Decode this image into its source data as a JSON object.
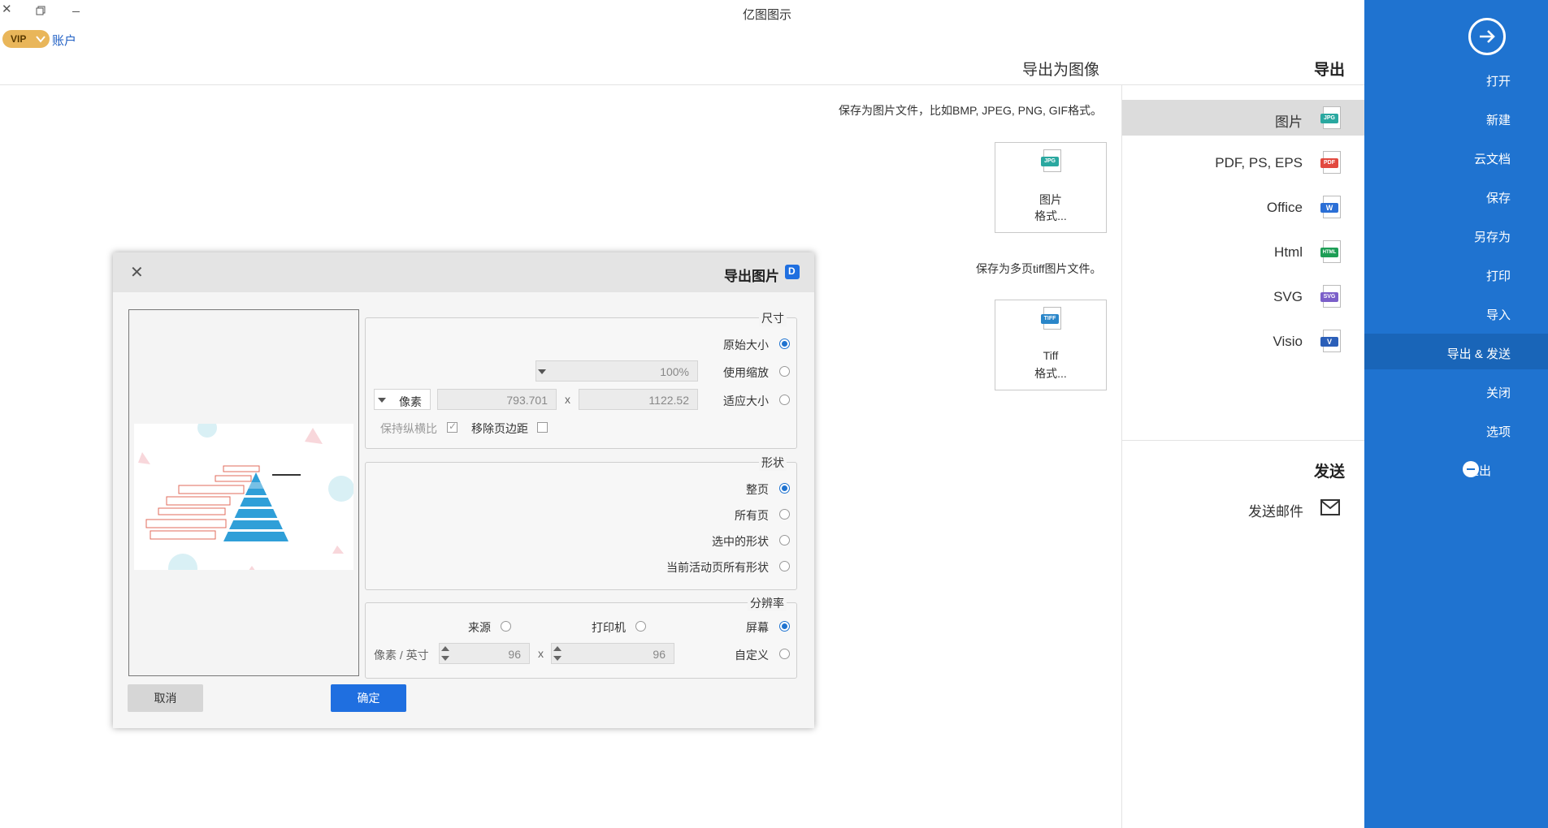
{
  "app": {
    "title": "亿图图示",
    "vip_label": "VIP",
    "user_label": "账户"
  },
  "sidebar": {
    "items": [
      {
        "label": "打开"
      },
      {
        "label": "新建"
      },
      {
        "label": "云文档"
      },
      {
        "label": "保存"
      },
      {
        "label": "另存为"
      },
      {
        "label": "打印"
      },
      {
        "label": "导入"
      },
      {
        "label": "导出 & 发送"
      },
      {
        "label": "关闭"
      },
      {
        "label": "选项"
      },
      {
        "label": "退出"
      }
    ],
    "active": "导出 & 发送"
  },
  "export_panel": {
    "heading": "导出",
    "formats": [
      {
        "label": "图片",
        "tag": "JPG",
        "color": "#2aa8a0"
      },
      {
        "label": "PDF, PS, EPS",
        "tag": "PDF",
        "color": "#e2493f"
      },
      {
        "label": "Office",
        "tag": "W",
        "color": "#2b6fd6"
      },
      {
        "label": "Html",
        "tag": "HTML",
        "color": "#1e9e56"
      },
      {
        "label": "SVG",
        "tag": "SVG",
        "color": "#7b5fc9"
      },
      {
        "label": "Visio",
        "tag": "V",
        "color": "#2b5fb8"
      }
    ],
    "send_heading": "发送",
    "send_email": "发送邮件"
  },
  "content": {
    "title": "导出为图像",
    "image_desc": "保存为图片文件，比如BMP, JPEG, PNG, GIF格式。",
    "image_card": {
      "line1": "图片",
      "line2": "格式..."
    },
    "tiff_desc": "保存为多页tiff图片文件。",
    "tiff_card": {
      "line1": "Tiff",
      "line2": "格式..."
    }
  },
  "dialog": {
    "title": "导出图片",
    "size_group": {
      "title": "尺寸",
      "original": "原始大小",
      "use_scale": "使用缩放",
      "scale_value": "100%",
      "fit_size": "适应大小",
      "width": "1122.52",
      "height": "793.701",
      "times": "x",
      "unit": "像素",
      "remove_margin": "移除页边距",
      "keep_ratio": "保持纵横比"
    },
    "shape_group": {
      "title": "形状",
      "options": [
        "整页",
        "所有页",
        "选中的形状",
        "当前活动页所有形状"
      ]
    },
    "resolution_group": {
      "title": "分辨率",
      "screen": "屏幕",
      "printer": "打印机",
      "source": "来源",
      "custom": "自定义",
      "dpi_x": "96",
      "dpi_y": "96",
      "times": "x",
      "unit": "像素 / 英寸"
    },
    "ok": "确定",
    "cancel": "取消"
  },
  "colors": {
    "sidebar_bg": "#1f73d0",
    "sidebar_active": "#1965b8",
    "accent": "#1f6fe0",
    "vip_gold": "#e9b65a"
  }
}
